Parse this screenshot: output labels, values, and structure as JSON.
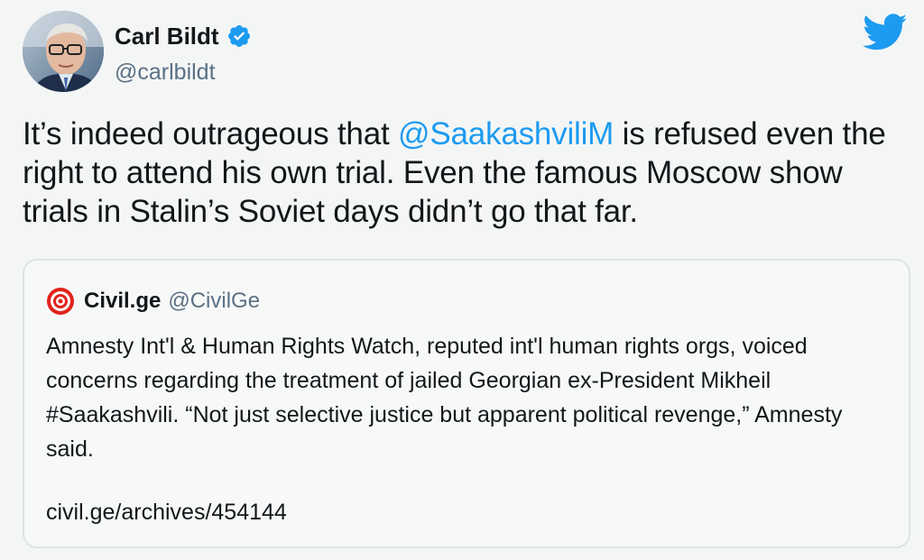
{
  "author": {
    "display_name": "Carl Bildt",
    "handle": "@carlbildt",
    "verified": true,
    "avatar": "profile-photo"
  },
  "tweet": {
    "text_before": "It’s indeed outrageous that ",
    "mention": "@SaakashviliM",
    "text_after": " is refused even the right to attend his own trial. Even the famous Moscow show trials in Stalin’s Soviet days didn’t go that far."
  },
  "quoted_tweet": {
    "display_name": "Civil.ge",
    "handle": "@CivilGe",
    "text": "Amnesty Int'l & Human Rights Watch, reputed int'l human rights orgs, voiced concerns regarding the treatment of jailed Georgian ex-President Mikheil #Saakashvili. “Not just selective justice but apparent political revenge,” Amnesty said.",
    "link": "civil.ge/archives/454144"
  },
  "colors": {
    "accent": "#1d9bf0",
    "text": "#14171a",
    "secondary": "#5b7083",
    "background": "#f4f6f6"
  },
  "icons": {
    "brand": "twitter-bird-icon",
    "verified": "verified-badge-icon",
    "quoted_logo": "civil-ge-logo"
  }
}
